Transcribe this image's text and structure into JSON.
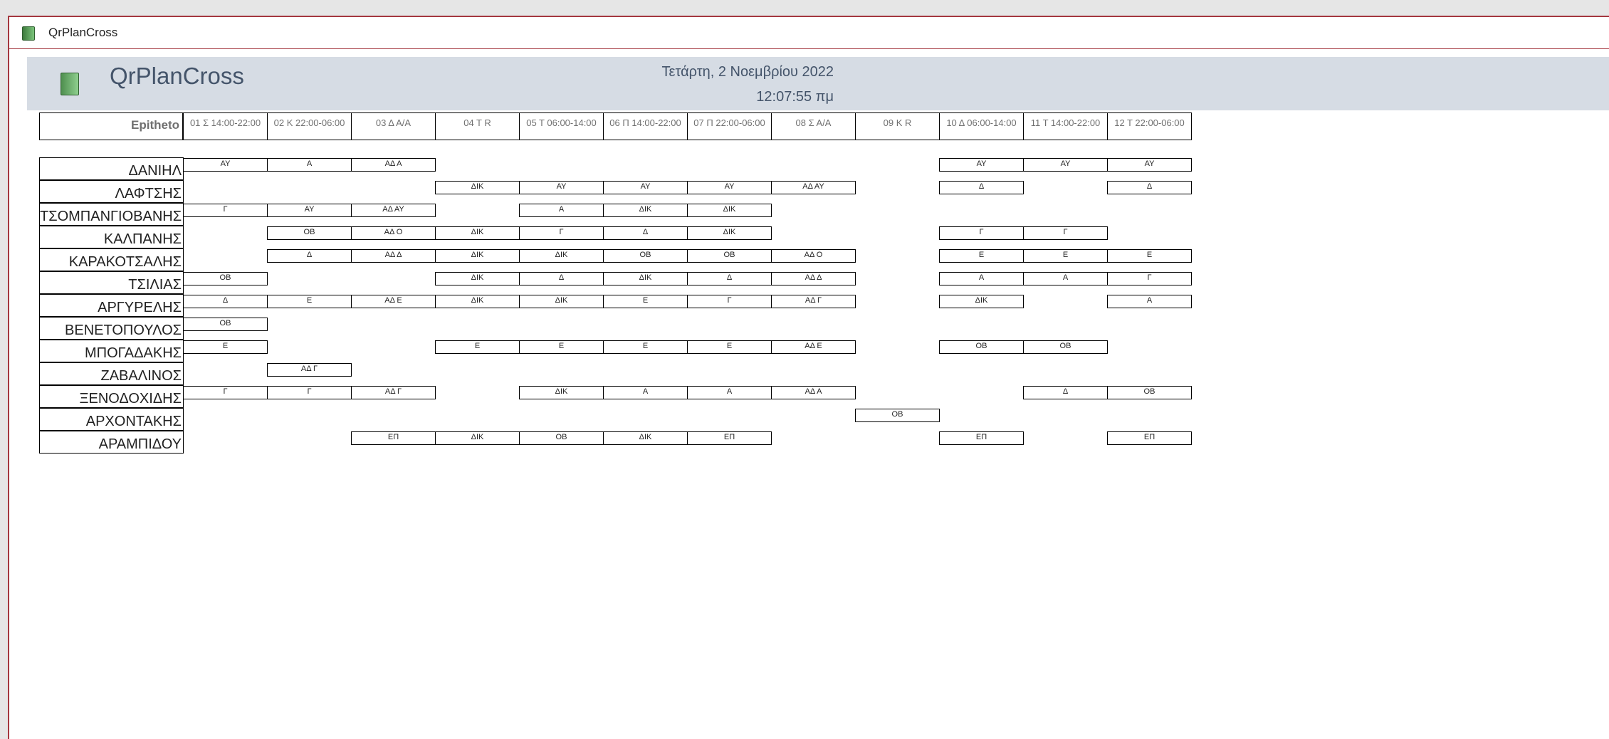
{
  "tab": {
    "title": "QrPlanCross"
  },
  "header": {
    "title": "QrPlanCross",
    "date": "Τετάρτη, 2 Νοεμβρίου 2022",
    "time": "12:07:55 πμ"
  },
  "columns": {
    "name_header": "Epitheto",
    "days": [
      "01 Σ 14:00-22:00",
      "02 Κ 22:00-06:00",
      "03 Δ Α/Α",
      "04 T R",
      "05 Τ 06:00-14:00",
      "06 Π 14:00-22:00",
      "07 Π 22:00-06:00",
      "08 Σ Α/Α",
      "09 K R",
      "10 Δ 06:00-14:00",
      "11 Τ 14:00-22:00",
      "12 Τ 22:00-06:00"
    ]
  },
  "rows": [
    {
      "name": "ΔΑΝΙΗΛ",
      "cells": [
        "ΑΥ",
        "Α",
        "ΑΔ Α",
        "",
        "",
        "",
        "",
        "",
        "",
        "ΑΥ",
        "ΑΥ",
        "ΑΥ"
      ]
    },
    {
      "name": "ΛΑΦΤΣΗΣ",
      "cells": [
        "",
        "",
        "",
        "ΔΙΚ",
        "ΑΥ",
        "ΑΥ",
        "ΑΥ",
        "ΑΔ ΑΥ",
        "",
        "Δ",
        "",
        "Δ"
      ]
    },
    {
      "name": "ΤΣΟΜΠΑΝΓΙΟΒΑΝΗΣ",
      "cells": [
        "Γ",
        "ΑΥ",
        "ΑΔ ΑΥ",
        "",
        "Α",
        "ΔΙΚ",
        "ΔΙΚ",
        "",
        "",
        "",
        "",
        ""
      ]
    },
    {
      "name": "ΚΑΛΠΑΝΗΣ",
      "cells": [
        "",
        "ΟΒ",
        "ΑΔ Ο",
        "ΔΙΚ",
        "Γ",
        "Δ",
        "ΔΙΚ",
        "",
        "",
        "Γ",
        "Γ",
        ""
      ]
    },
    {
      "name": "ΚΑΡΑΚΟΤΣΑΛΗΣ",
      "cells": [
        "",
        "Δ",
        "ΑΔ Δ",
        "ΔΙΚ",
        "ΔΙΚ",
        "ΟΒ",
        "ΟΒ",
        "ΑΔ Ο",
        "",
        "Ε",
        "Ε",
        "Ε"
      ]
    },
    {
      "name": "ΤΣΙΛΙΑΣ",
      "cells": [
        "ΟΒ",
        "",
        "",
        "ΔΙΚ",
        "Δ",
        "ΔΙΚ",
        "Δ",
        "ΑΔ Δ",
        "",
        "Α",
        "Α",
        "Γ"
      ]
    },
    {
      "name": "ΑΡΓΥΡΕΛΗΣ",
      "cells": [
        "Δ",
        "Ε",
        "ΑΔ Ε",
        "ΔΙΚ",
        "ΔΙΚ",
        "Ε",
        "Γ",
        "ΑΔ Γ",
        "",
        "ΔΙΚ",
        "",
        "Α"
      ]
    },
    {
      "name": "ΒΕΝΕΤΟΠΟΥΛΟΣ",
      "cells": [
        "ΟΒ",
        "",
        "",
        "",
        "",
        "",
        "",
        "",
        "",
        "",
        "",
        ""
      ]
    },
    {
      "name": "ΜΠΟΓΑΔΑΚΗΣ",
      "cells": [
        "Ε",
        "",
        "",
        "Ε",
        "Ε",
        "Ε",
        "Ε",
        "ΑΔ Ε",
        "",
        "ΟΒ",
        "ΟΒ",
        ""
      ]
    },
    {
      "name": "ΖΑΒΑΛΙΝΟΣ",
      "cells": [
        "",
        "ΑΔ Γ",
        "",
        "",
        "",
        "",
        "",
        "",
        "",
        "",
        "",
        ""
      ]
    },
    {
      "name": "ΞΕΝΟΔΟΧΙΔΗΣ",
      "cells": [
        "Γ",
        "Γ",
        "ΑΔ Γ",
        "",
        "ΔΙΚ",
        "Α",
        "Α",
        "ΑΔ Α",
        "",
        "",
        "Δ",
        "ΟΒ"
      ]
    },
    {
      "name": "ΑΡΧΟΝΤΑΚΗΣ",
      "cells": [
        "",
        "",
        "",
        "",
        "",
        "",
        "",
        "",
        "ΟΒ",
        "",
        "",
        ""
      ]
    },
    {
      "name": "ΑΡΑΜΠΙΔΟΥ",
      "cells": [
        "",
        "",
        "ΕΠ",
        "ΔΙΚ",
        "ΟΒ",
        "ΔΙΚ",
        "ΕΠ",
        "",
        "",
        "ΕΠ",
        "",
        "ΕΠ"
      ]
    }
  ]
}
